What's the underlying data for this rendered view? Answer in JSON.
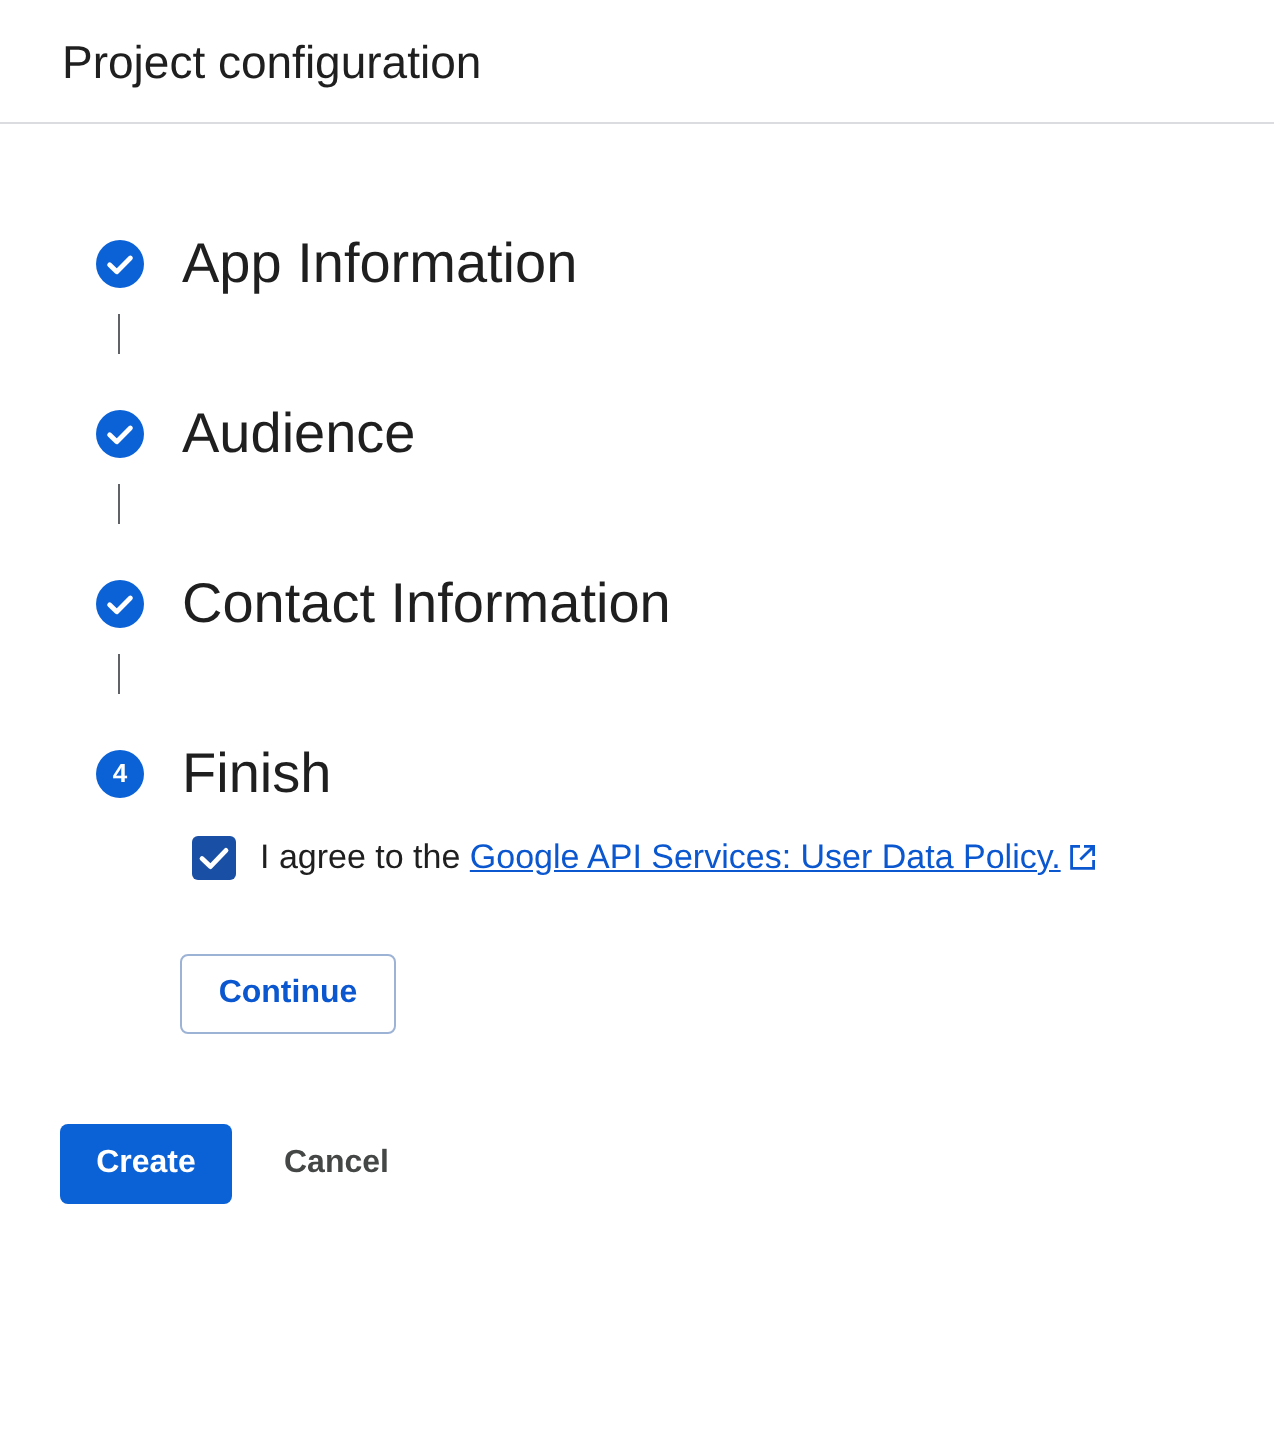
{
  "header": {
    "title": "Project configuration"
  },
  "steps": [
    {
      "title": "App Information",
      "completed": true
    },
    {
      "title": "Audience",
      "completed": true
    },
    {
      "title": "Contact Information",
      "completed": true
    },
    {
      "title": "Finish",
      "completed": false,
      "number": "4",
      "agreement": {
        "checked": true,
        "text": "I agree to the ",
        "link": "Google API Services: User Data Policy."
      },
      "continue_button": "Continue"
    }
  ],
  "actions": [
    {
      "label": "Create",
      "kind": "primary"
    },
    {
      "label": "Cancel",
      "kind": "text"
    }
  ]
}
